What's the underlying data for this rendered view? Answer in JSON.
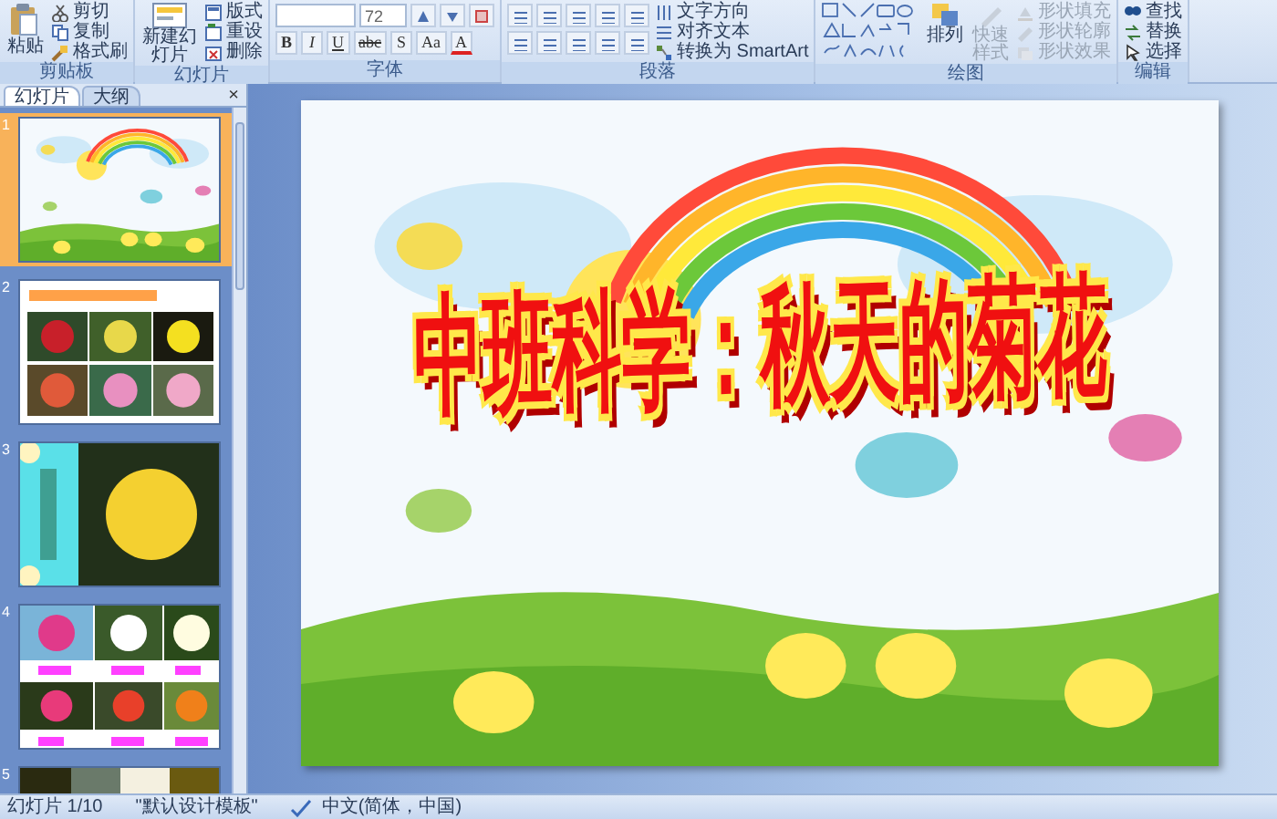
{
  "ribbon": {
    "groups": [
      {
        "kind": "clipboard",
        "label": "剪贴板",
        "large": "粘贴",
        "items": [
          {
            "label": "剪切"
          },
          {
            "label": "复制"
          },
          {
            "label": "格式刷"
          }
        ]
      },
      {
        "kind": "slides",
        "label": "幻灯片",
        "large": "新建幻灯片",
        "items": [
          {
            "label": "版式"
          },
          {
            "label": "重设"
          },
          {
            "label": "删除"
          }
        ]
      },
      {
        "kind": "font",
        "label": "字体",
        "font_size": "72",
        "buttons": [
          "B",
          "I",
          "U",
          "abc",
          "S",
          "Aa",
          "A"
        ]
      },
      {
        "kind": "paragraph",
        "label": "段落",
        "items": [
          {
            "label": "文字方向"
          },
          {
            "label": "对齐文本"
          },
          {
            "label": "转换为 SmartArt"
          }
        ]
      },
      {
        "kind": "drawing",
        "label": "绘图",
        "large": [
          {
            "label": "排列",
            "disabled": false
          },
          {
            "label": "快速样式",
            "disabled": true
          }
        ],
        "items": [
          {
            "label": "形状填充",
            "disabled": true
          },
          {
            "label": "形状轮廓",
            "disabled": true
          },
          {
            "label": "形状效果",
            "disabled": true
          }
        ]
      },
      {
        "kind": "editing",
        "label": "编辑",
        "items": [
          {
            "label": "查找"
          },
          {
            "label": "替换"
          },
          {
            "label": "选择"
          }
        ]
      }
    ]
  },
  "pane": {
    "tabs": [
      {
        "label": "幻灯片",
        "selected": true
      },
      {
        "label": "大纲",
        "selected": false
      }
    ],
    "close": "×",
    "slides": [
      {
        "number": "1",
        "selected": true
      },
      {
        "number": "2",
        "selected": false
      },
      {
        "number": "3",
        "selected": false
      },
      {
        "number": "4",
        "selected": false
      },
      {
        "number": "5",
        "selected": false
      }
    ]
  },
  "slide": {
    "title": "中班科学：秋天的菊花"
  },
  "status_bar": {
    "slide": "幻灯片 1/10",
    "theme": "\"默认设计模板\"",
    "language": "中文(简体，中国)"
  }
}
